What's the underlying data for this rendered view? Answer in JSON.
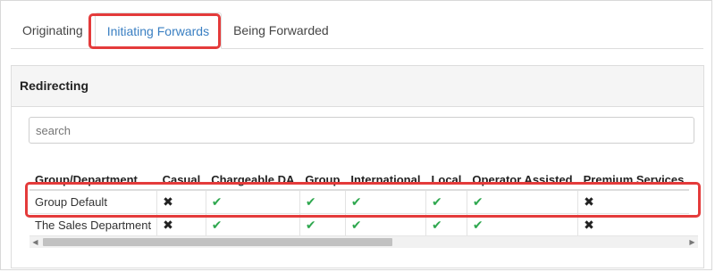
{
  "tabs": [
    {
      "label": "Originating"
    },
    {
      "label": "Initiating Forwards"
    },
    {
      "label": "Being Forwarded"
    }
  ],
  "active_tab": "Initiating Forwards",
  "panel": {
    "title": "Redirecting"
  },
  "search": {
    "placeholder": "search",
    "value": ""
  },
  "table": {
    "columns": [
      "Group/Department",
      "Casual",
      "Chargeable DA",
      "Group",
      "International",
      "Local",
      "Operator Assisted",
      "Premium Services"
    ],
    "rows": [
      {
        "name": "Group Default",
        "values": [
          false,
          true,
          true,
          true,
          true,
          true,
          false
        ]
      },
      {
        "name": "The Sales Department",
        "values": [
          false,
          true,
          true,
          true,
          true,
          true,
          false
        ]
      }
    ]
  },
  "icons": {
    "allowed": "check-icon",
    "denied": "x-icon"
  },
  "colors": {
    "accent": "#3a7fc2",
    "allowed": "#2fa84f",
    "highlight": "#e43b3b"
  },
  "scrollbar": {
    "left_arrow": "◀",
    "right_arrow": "▶"
  }
}
